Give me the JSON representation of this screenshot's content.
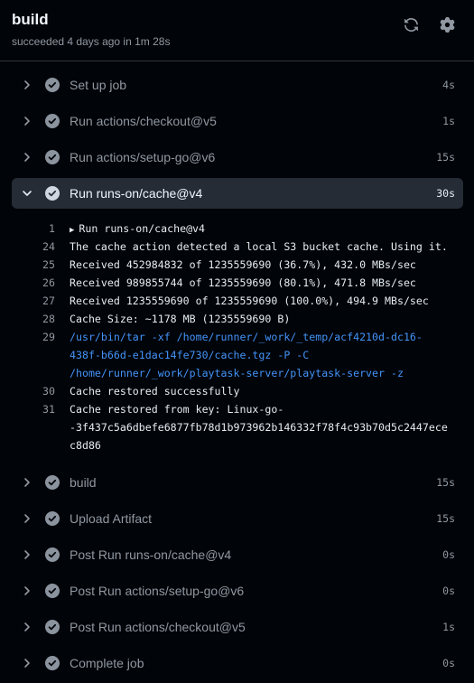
{
  "header": {
    "title": "build",
    "subtitle": "succeeded 4 days ago in 1m 28s",
    "refresh_icon": "sync-icon",
    "settings_icon": "gear-icon"
  },
  "colors": {
    "background": "#010409",
    "success_check": "#8b949e",
    "command_text": "#4493f8",
    "expanded_row": "#262c36"
  },
  "steps_before": [
    {
      "name": "Set up job",
      "duration": "4s"
    },
    {
      "name": "Run actions/checkout@v5",
      "duration": "1s"
    },
    {
      "name": "Run actions/setup-go@v6",
      "duration": "15s"
    }
  ],
  "expanded_step": {
    "name": "Run runs-on/cache@v4",
    "duration": "30s"
  },
  "log": {
    "group_line": {
      "num": "1",
      "text": "Run runs-on/cache@v4"
    },
    "lines": [
      {
        "num": "24",
        "text": "The cache action detected a local S3 bucket cache. Using it."
      },
      {
        "num": "25",
        "text": "Received 452984832 of 1235559690 (36.7%), 432.0 MBs/sec"
      },
      {
        "num": "26",
        "text": "Received 989855744 of 1235559690 (80.1%), 471.8 MBs/sec"
      },
      {
        "num": "27",
        "text": "Received 1235559690 of 1235559690 (100.0%), 494.9 MBs/sec"
      },
      {
        "num": "28",
        "text": "Cache Size: ~1178 MB (1235559690 B)"
      },
      {
        "num": "29",
        "text": "/usr/bin/tar -xf /home/runner/_work/_temp/acf4210d-dc16-"
      },
      {
        "num": "",
        "text": "438f-b66d-e1dac14fe730/cache.tgz -P -C"
      },
      {
        "num": "",
        "text": "/home/runner/_work/playtask-server/playtask-server -z"
      },
      {
        "num": "30",
        "text": "Cache restored successfully"
      },
      {
        "num": "31",
        "text": "Cache restored from key: Linux-go-"
      },
      {
        "num": "",
        "text": "-3f437c5a6dbefe6877fb78d1b973962b146332f78f4c93b70d5c2447ece"
      },
      {
        "num": "",
        "text": "c8d86"
      }
    ]
  },
  "steps_after": [
    {
      "name": "build",
      "duration": "15s"
    },
    {
      "name": "Upload Artifact",
      "duration": "15s"
    },
    {
      "name": "Post Run runs-on/cache@v4",
      "duration": "0s"
    },
    {
      "name": "Post Run actions/setup-go@v6",
      "duration": "0s"
    },
    {
      "name": "Post Run actions/checkout@v5",
      "duration": "1s"
    },
    {
      "name": "Complete job",
      "duration": "0s"
    }
  ]
}
